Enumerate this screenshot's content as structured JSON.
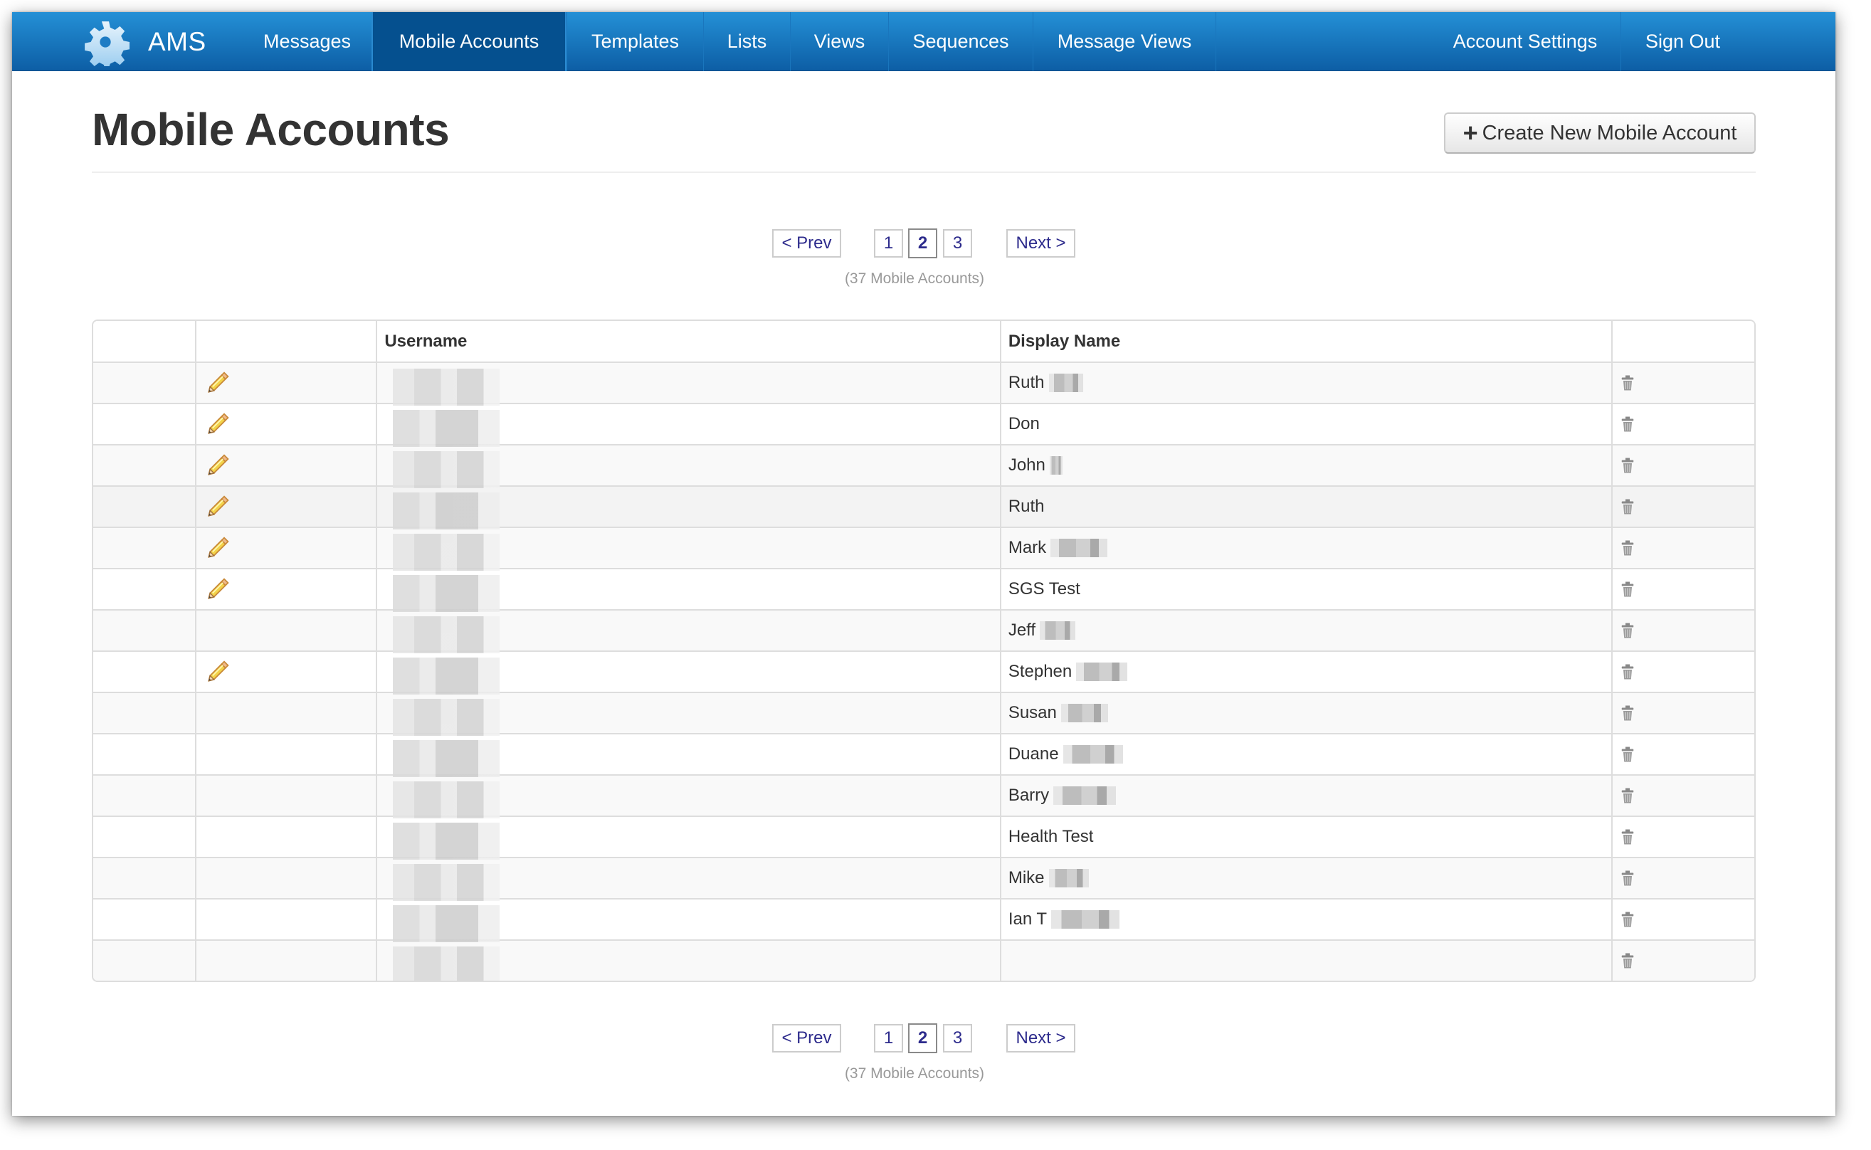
{
  "app": {
    "brand": "AMS",
    "logo_icon": "gear-speech-icon"
  },
  "nav": {
    "items": [
      {
        "label": "Messages",
        "active": false
      },
      {
        "label": "Mobile Accounts",
        "active": true
      },
      {
        "label": "Templates",
        "active": false
      },
      {
        "label": "Lists",
        "active": false
      },
      {
        "label": "Views",
        "active": false
      },
      {
        "label": "Sequences",
        "active": false
      },
      {
        "label": "Message Views",
        "active": false
      }
    ],
    "right_items": [
      {
        "label": "Account Settings"
      },
      {
        "label": "Sign Out"
      }
    ],
    "colors": {
      "bar_top": "#2490d6",
      "bar_bottom": "#0d5ea5",
      "active": "#05508f"
    }
  },
  "page": {
    "title": "Mobile Accounts",
    "create_button": {
      "icon": "plus-icon",
      "label": "Create New Mobile Account"
    }
  },
  "pagination": {
    "prev_label": "< Prev",
    "next_label": "Next >",
    "pages": [
      "1",
      "2",
      "3"
    ],
    "current_page": "2",
    "count_text": "(37 Mobile Accounts)",
    "link_color": "#2d2b8c"
  },
  "table": {
    "columns": [
      "",
      "",
      "Username",
      "Display Name",
      ""
    ],
    "rows": [
      {
        "editable": true,
        "username": "[redacted]",
        "display_name": "Ruth",
        "name_redacted": true
      },
      {
        "editable": true,
        "username": "[redacted]",
        "display_name": "Don",
        "name_redacted": false
      },
      {
        "editable": true,
        "username": "[redacted]",
        "display_name": "John",
        "name_redacted": true
      },
      {
        "editable": true,
        "username": "[redacted]",
        "display_name": "Ruth",
        "name_redacted": false
      },
      {
        "editable": true,
        "username": "[redacted]",
        "display_name": "Mark",
        "name_redacted": true
      },
      {
        "editable": true,
        "username": "[redacted]",
        "display_name": "SGS Test",
        "name_redacted": false
      },
      {
        "editable": false,
        "username": "[redacted]",
        "display_name": "Jeff",
        "name_redacted": true
      },
      {
        "editable": true,
        "username": "[redacted]",
        "display_name": "Stephen",
        "name_redacted": true
      },
      {
        "editable": false,
        "username": "[redacted]",
        "display_name": "Susan",
        "name_redacted": true
      },
      {
        "editable": false,
        "username": "[redacted]",
        "display_name": "Duane",
        "name_redacted": true
      },
      {
        "editable": false,
        "username": "[redacted]",
        "display_name": "Barry",
        "name_redacted": true
      },
      {
        "editable": false,
        "username": "[redacted]",
        "display_name": "Health Test",
        "name_redacted": false
      },
      {
        "editable": false,
        "username": "[redacted]",
        "display_name": "Mike",
        "name_redacted": true
      },
      {
        "editable": false,
        "username": "[redacted]",
        "display_name": "Ian T",
        "name_redacted": true
      },
      {
        "editable": false,
        "username": "[redacted]",
        "display_name": "",
        "name_redacted": false
      }
    ],
    "hovered_row": 3,
    "row_icons": {
      "edit": "pencil-icon",
      "delete": "trash-icon"
    }
  }
}
